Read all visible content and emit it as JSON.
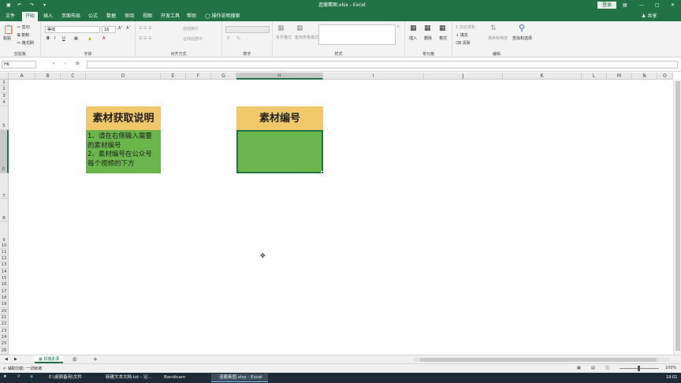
{
  "titlebar": {
    "file": "追撤素图.xlsx",
    "sep": "-",
    "app": "Excel",
    "login": "登录",
    "undo_icon": "undo-icon",
    "redo_icon": "redo-icon",
    "save_icon": "save-icon"
  },
  "tabs": [
    "文件",
    "开始",
    "插入",
    "页面布局",
    "公式",
    "数据",
    "审阅",
    "视图",
    "开发工具",
    "帮助"
  ],
  "tell_me": "操作说明搜索",
  "share": "共享",
  "ribbon": {
    "clipboard": {
      "paste": "粘贴",
      "cut": "剪切",
      "copy": "复制",
      "format_painter": "格式刷",
      "label": "剪贴板"
    },
    "font": {
      "name": "等线",
      "size": "16",
      "bold": "B",
      "italic": "I",
      "underline": "U",
      "label": "字体"
    },
    "alignment": {
      "wrap": "自动换行",
      "merge": "合并后居中",
      "label": "对齐方式"
    },
    "number": {
      "label": "数字",
      "percent": "%"
    },
    "styles": {
      "conditional": "条件格式",
      "table": "套用表格格式",
      "label": "样式"
    },
    "cells": {
      "insert": "插入",
      "delete": "删除",
      "format": "格式",
      "label": "单元格"
    },
    "editing": {
      "autosum": "自动求和",
      "fill": "填充",
      "clear": "清除",
      "sort": "排序和筛选",
      "find": "查找和选择",
      "label": "编辑"
    }
  },
  "formula_bar": {
    "name_box": "H6",
    "fx": "fx",
    "cancel": "✕",
    "enter": "✓",
    "content": ""
  },
  "columns": [
    "A",
    "B",
    "C",
    "D",
    "E",
    "F",
    "G",
    "H",
    "I",
    "J",
    "K",
    "L",
    "M",
    "N",
    "O"
  ],
  "rows": [
    "1",
    "2",
    "3",
    "4",
    "5",
    "6",
    "7",
    "8",
    "9",
    "10",
    "11",
    "12",
    "13",
    "14",
    "15",
    "16",
    "17",
    "18",
    "19",
    "20",
    "21",
    "22",
    "23",
    "24",
    "25",
    "26"
  ],
  "cells": {
    "d5": "素材获取说明",
    "d6_line1": "1、请在右侧输入需要",
    "d6_line2": "的素材编号",
    "d6_line3": "2、素材编号在公众号",
    "d6_line4": "每个视频的下方",
    "h5": "素材编号",
    "h6": ""
  },
  "colors": {
    "excel_green": "#217346",
    "header_gold": "#f0c86a",
    "cell_green": "#6ab64a"
  },
  "sheet_tabs": {
    "active": "猜撤素源",
    "other": "源",
    "add": "+"
  },
  "status": {
    "ready": "辅助功能: 一切就绪",
    "zoom": "100%"
  },
  "taskbar": {
    "items": [
      "E:\\桌面备用\\文件",
      "新建文本文档.txt - 记...",
      "Bandicam",
      "追撤素图.xlsx - Excel"
    ],
    "time": "19:01"
  }
}
